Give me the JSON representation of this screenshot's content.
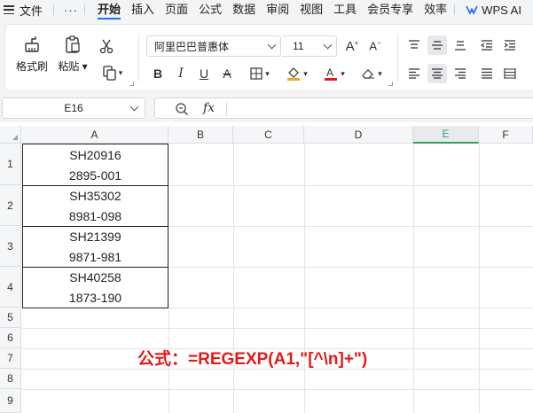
{
  "menubar": {
    "file_label": "文件",
    "more_label": "···",
    "tabs": [
      "开始",
      "插入",
      "页面",
      "公式",
      "数据",
      "审阅",
      "视图",
      "工具",
      "会员专享",
      "效率"
    ],
    "active_tab": "开始",
    "wps_ai_label": "WPS AI"
  },
  "ribbon": {
    "format_painter_label": "格式刷",
    "paste_label": "粘贴",
    "font_name": "阿里巴巴普惠体",
    "font_size": "11"
  },
  "formula_bar": {
    "name_box": "E16",
    "fx_label": "fx",
    "formula_value": ""
  },
  "sheet": {
    "columns": [
      "A",
      "B",
      "C",
      "D",
      "E",
      "F"
    ],
    "active_column": "E",
    "rows": [
      "1",
      "2",
      "3",
      "4",
      "5",
      "6",
      "7",
      "8",
      "9"
    ],
    "cells_A": [
      [
        "SH20916",
        "2895-001"
      ],
      [
        "SH35302",
        "8981-098"
      ],
      [
        "SH21399",
        "9871-981"
      ],
      [
        "SH40258",
        "1873-190"
      ]
    ]
  },
  "annotation": {
    "text": "公式：=REGEXP(A1,\"[^\\n]+\")",
    "color": "#e31a1a"
  },
  "colors": {
    "accent_blue": "#1f6bff",
    "active_green": "#2f9e61",
    "font_color_red": "#e31a1a",
    "fill_orange": "#f5a623"
  }
}
